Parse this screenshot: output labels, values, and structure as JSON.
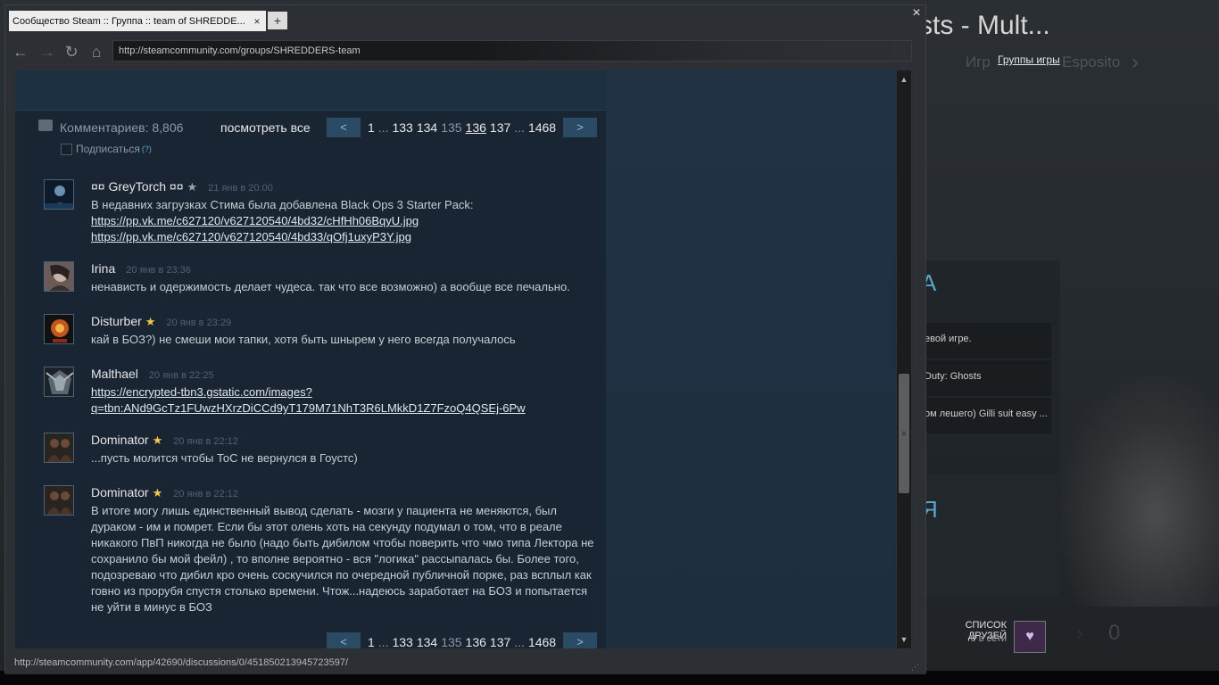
{
  "background": {
    "title": "sts - Mult...",
    "faded_left": "Игр",
    "groups_link": "Группы игры",
    "faded_right": "Esposito",
    "panel_letter": "A",
    "rows": [
      "евой игре.",
      "Duty: Ghosts",
      "ом лешего) Gilli suit easy ..."
    ],
    "panel2_letter": "Я",
    "friends_label": "СПИСОК ДРУЗЕЙ",
    "friends_online": "0 в сети",
    "zero": "0"
  },
  "window": {
    "tab_title": "Сообщество Steam :: Группа :: team of SHREDDE...",
    "tab_close": "×",
    "new_tab": "+",
    "close": "×",
    "url": "http://steamcommunity.com/groups/SHREDDERS-team",
    "status_url": "http://steamcommunity.com/app/42690/discussions/0/451850213945723597/"
  },
  "comments_header": {
    "count_label": "Комментариев: 8,806",
    "view_all": "посмотреть все",
    "subscribe": "Подписаться",
    "subscribe_help": "(?)"
  },
  "pager_top": {
    "prev": "<",
    "next": ">",
    "first": "1",
    "dots1": "...",
    "p1": "133",
    "p2": "134",
    "current": "135",
    "p4": "136",
    "p5": "137",
    "dots2": "...",
    "last": "1468"
  },
  "pager_bottom": {
    "prev": "<",
    "next": ">",
    "first": "1",
    "dots1": "...",
    "p1": "133",
    "p2": "134",
    "current": "135",
    "p4": "136",
    "p5": "137",
    "dots2": "...",
    "last": "1468"
  },
  "comments": [
    {
      "author": "¤¤ GreyTorch ¤¤",
      "star": "★",
      "date": "21 янв в 20:00",
      "text": "В недавних загрузках Стима была добавлена Black Ops 3 Starter Pack:",
      "links": [
        "https://pp.vk.me/c627120/v627120540/4bd32/cHfHh06BqyU.jpg",
        "https://pp.vk.me/c627120/v627120540/4bd33/qOfj1uxyP3Y.jpg"
      ]
    },
    {
      "author": "Irina",
      "date": "20 янв в 23:36",
      "text": "ненависть и одержимость делает чудеса. так что все возможно) а вообще все печально."
    },
    {
      "author": "Disturber",
      "star": "★",
      "date": "20 янв в 23:29",
      "text": "кай в БОЗ?) не смеши мои тапки, хотя быть шнырем у него всегда получалось"
    },
    {
      "author": "Malthael",
      "date": "20 янв в 22:25",
      "links": [
        "https://encrypted-tbn3.gstatic.com/images?",
        "q=tbn:ANd9GcTz1FUwzHXrzDiCCd9yT179M71NhT3R6LMkkD1Z7FzoQ4QSEj-6Pw"
      ]
    },
    {
      "author": "Dominator",
      "star": "★",
      "date": "20 янв в 22:12",
      "text": "...пусть молится чтобы ТоС не вернулся в Гоустс)"
    },
    {
      "author": "Dominator",
      "star": "★",
      "date": "20 янв в 22:12",
      "text": "В итоге могу лишь единственный вывод сделать - мозги у пациента не меняются, был дураком - им и помрет. Если бы этот олень хоть на секунду подумал о том, что в реале никакого ПвП никогда не было (надо быть дибилом чтобы поверить что чмо типа Лектора не сохранило бы мой фейл) , то вполне вероятно - вся \"логика\" рассыпалась бы. Более того, подозреваю что дибил кро очень соскучился по очередной публичной порке, раз всплыл как говно из прорубя спустя столько времени. Чтож...надеюсь заработает на БОЗ и попытается не уйти в минус в БОЗ"
    }
  ],
  "colors": {
    "accent": "#56a7cf",
    "star": "#f2c94c",
    "pager_bg": "#2b4a64"
  }
}
